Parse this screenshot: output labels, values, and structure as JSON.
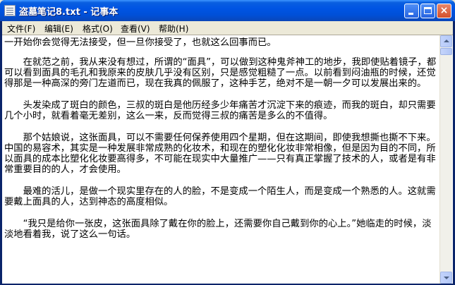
{
  "window": {
    "title": "盗墓笔记8.txt - 记事本",
    "minimize_label": "",
    "maximize_label": "",
    "close_label": "×"
  },
  "menu": {
    "items": [
      {
        "label": "文件(F)"
      },
      {
        "label": "编辑(E)"
      },
      {
        "label": "格式(O)"
      },
      {
        "label": "查看(V)"
      },
      {
        "label": "帮助(H)"
      }
    ]
  },
  "document": {
    "paragraphs": [
      "一开始你会觉得无法接受，但一旦你接受了，也就这么回事而已。",
      "　　在就范之前，我从来没有想过，所谓的“面具”，可以做到这种鬼斧神工的地步，我即使贴着镜子，都可以看到面具的毛孔和我原来的皮肤几乎没有区别，只是感觉粗糙了一点。以前看到闷油瓶的时候，还觉得那是一种高深的旁门左道而已，现在我真的佩服了，这种手艺，绝对不是一朝一夕可以发展出来的。",
      "　　头发染成了斑白的颜色，三叔的斑白是他历经多少年痛苦才沉淀下来的痕迹，而我的斑白，却只需要几个小时，就看着毫无差别，这么一来，反而觉得三叔的痛苦是多么的不值得。",
      "　　那个姑娘说，这张面具，可以不需要任何保养使用四个星期，但在这期间，即使我想撕也撕不下来。中国的易容术，其实是一种发展非常成熟的化妆术，和现在的塑化化妆非常相像，但是因为目的不同，所以面具的成本比塑化化妆要高得多，不可能在现实中大量推广——只有真正掌握了技术的人，或者是有非常重要目的的人，才会使用。",
      "　　最难的活儿，是做一个现实里存在的人的脸，不是变成一个陌生人，而是变成一个熟悉的人。这就需要戴上面具的人，达到神态的高度相似。",
      "　　“我只是给你一张皮，这张面具除了戴在你的脸上，还需要你自己戴到你的心上。”她临走的时候，淡淡地看着我，说了这么一句话。"
    ]
  },
  "colors": {
    "titlebar": "#0054e3",
    "menubar": "#ece9d8",
    "editor_bg": "#ffffff",
    "scrollbar": "#b4c8f6"
  }
}
